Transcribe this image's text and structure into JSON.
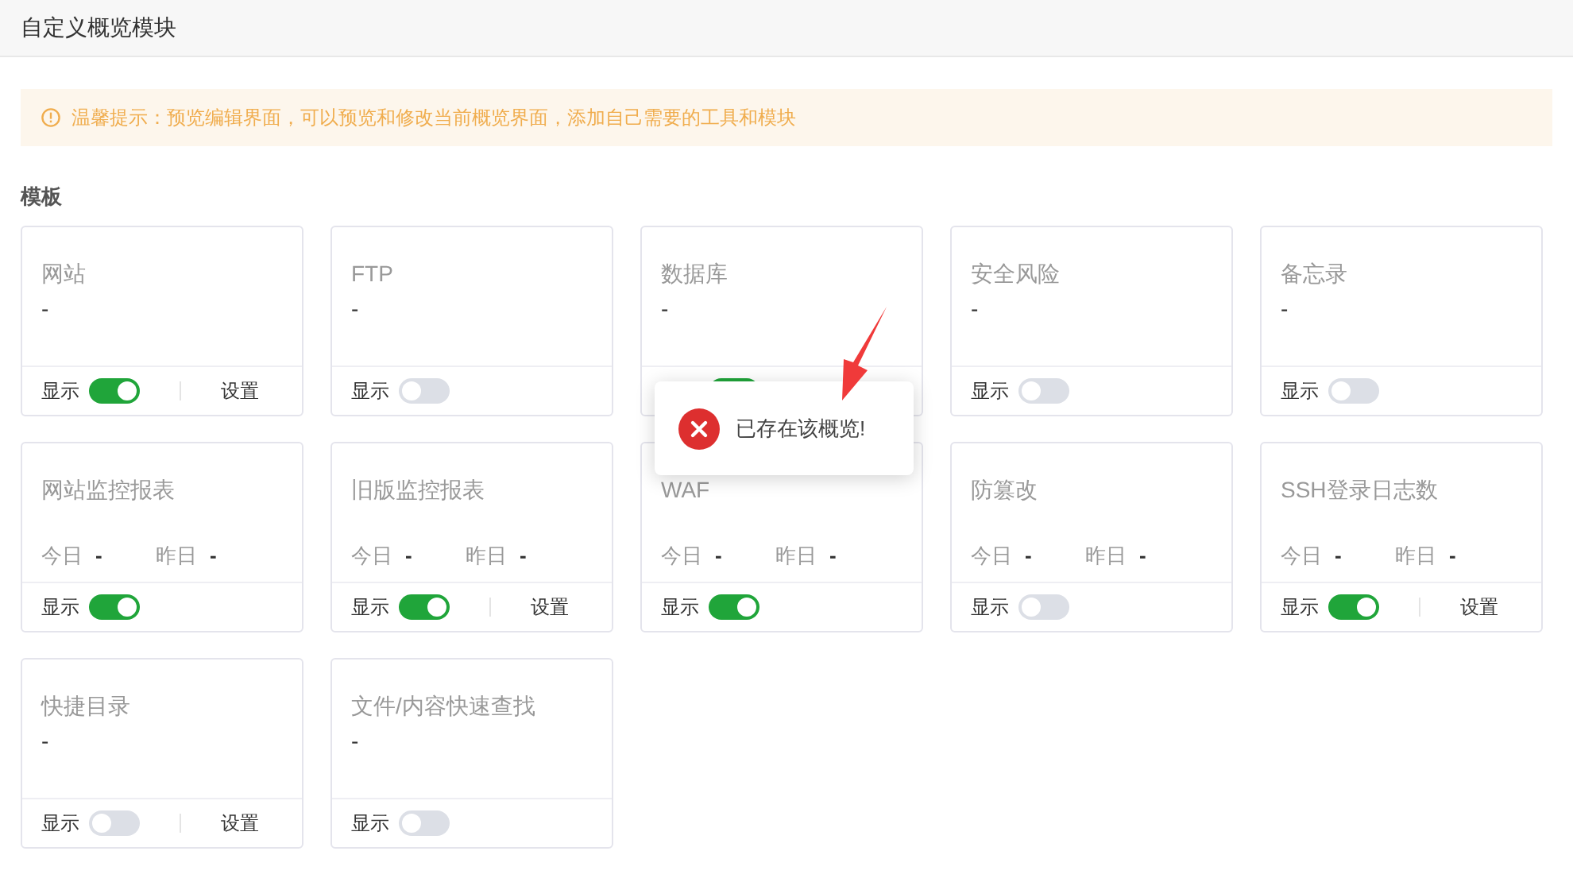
{
  "dialog": {
    "title": "自定义概览模块"
  },
  "notice": {
    "text": "温馨提示：预览编辑界面，可以预览和修改当前概览界面，添加自己需要的工具和模块"
  },
  "section": {
    "title": "模板"
  },
  "cards": [
    {
      "kind": "value",
      "title": "网站",
      "value": "-",
      "show_label": "显示",
      "on": true,
      "settings": "设置"
    },
    {
      "kind": "value",
      "title": "FTP",
      "value": "-",
      "show_label": "显示",
      "on": false
    },
    {
      "kind": "value",
      "title": "数据库",
      "value": "-",
      "on": true
    },
    {
      "kind": "value",
      "title": "安全风险",
      "value": "-",
      "show_label": "显示",
      "on": false
    },
    {
      "kind": "value",
      "title": "备忘录",
      "value": "-",
      "show_label": "显示",
      "on": false
    },
    {
      "kind": "stats",
      "title": "网站监控报表",
      "today_label": "今日",
      "today": "-",
      "yesterday_label": "昨日",
      "yesterday": "-",
      "show_label": "显示",
      "on": true
    },
    {
      "kind": "stats",
      "title": "旧版监控报表",
      "today_label": "今日",
      "today": "-",
      "yesterday_label": "昨日",
      "yesterday": "-",
      "show_label": "显示",
      "on": true,
      "settings": "设置"
    },
    {
      "kind": "stats",
      "title": "WAF",
      "today_label": "今日",
      "today": "-",
      "yesterday_label": "昨日",
      "yesterday": "-",
      "show_label": "显示",
      "on": true
    },
    {
      "kind": "stats",
      "title": "防篡改",
      "today_label": "今日",
      "today": "-",
      "yesterday_label": "昨日",
      "yesterday": "-",
      "show_label": "显示",
      "on": false
    },
    {
      "kind": "stats",
      "title": "SSH登录日志数",
      "today_label": "今日",
      "today": "-",
      "yesterday_label": "昨日",
      "yesterday": "-",
      "show_label": "显示",
      "on": true,
      "settings": "设置"
    },
    {
      "kind": "value",
      "title": "快捷目录",
      "value": "-",
      "show_label": "显示",
      "on": false,
      "settings": "设置"
    },
    {
      "kind": "value",
      "title": "文件/内容快速查找",
      "value": "-",
      "show_label": "显示",
      "on": false
    }
  ],
  "toast": {
    "text": "已存在该概览!"
  }
}
